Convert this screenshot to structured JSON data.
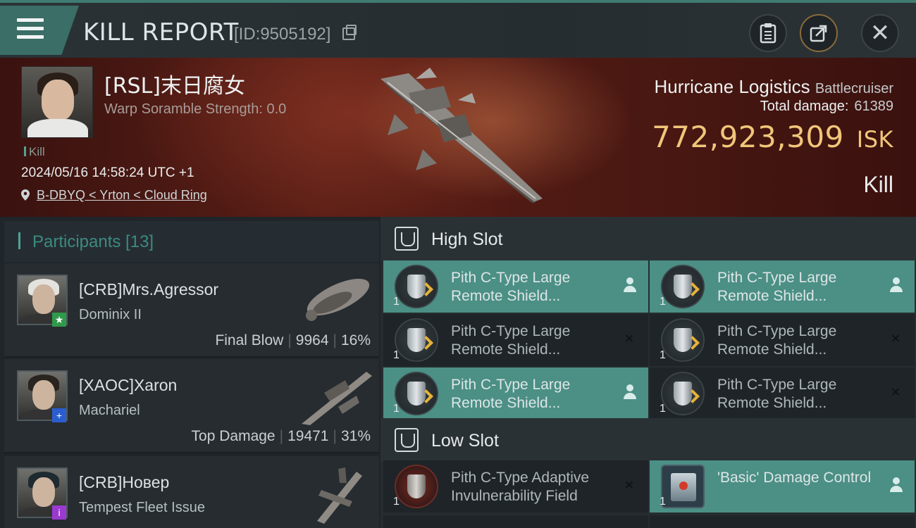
{
  "header": {
    "title": "KILL REPORT",
    "report_id": "[ID:9505192]"
  },
  "victim": {
    "name": "[RSL]末日腐女",
    "scramble": "Warp Soramble Strength: 0.0",
    "tag": "Kill",
    "datetime": "2024/05/16 14:58:24 UTC +1",
    "location": "B-DBYQ < Yrton < Cloud Ring",
    "ship": "Hurricane Logistics",
    "ship_class": "Battlecruiser",
    "total_damage_label": "Total damage:",
    "total_damage": "61389",
    "isk_value": "772,923,309",
    "isk_unit": "ISK",
    "result": "Kill"
  },
  "participants": {
    "header": "Participants [13]",
    "rows": [
      {
        "name": "[CRB]Mrs.Agressor",
        "ship": "Dominix II",
        "role": "Final Blow",
        "damage": "9964",
        "percent": "16%",
        "badge": "★",
        "badge_color": "#2f9a4a",
        "hair": "#e4e2dc"
      },
      {
        "name": "[XAOC]Xaron",
        "ship": "Machariel",
        "role": "Top Damage",
        "damage": "19471",
        "percent": "31%",
        "badge": "+",
        "badge_color": "#2a5ed0",
        "hair": "#2a2420"
      },
      {
        "name": "[CRB]Новер",
        "ship": "Tempest Fleet Issue",
        "role": "",
        "damage": "",
        "percent": "",
        "badge": "i",
        "badge_color": "#9a3ad0",
        "hair": "#1e2a30"
      }
    ]
  },
  "slots": {
    "high": {
      "label": "High Slot",
      "modules": [
        {
          "name": "Pith C-Type Large Remote Shield...",
          "qty": "1",
          "state": "dropped"
        },
        {
          "name": "Pith C-Type Large Remote Shield...",
          "qty": "1",
          "state": "dropped"
        },
        {
          "name": "Pith C-Type Large Remote Shield...",
          "qty": "1",
          "state": "destroyed"
        },
        {
          "name": "Pith C-Type Large Remote Shield...",
          "qty": "1",
          "state": "destroyed"
        },
        {
          "name": "Pith C-Type Large Remote Shield...",
          "qty": "1",
          "state": "dropped"
        },
        {
          "name": "Pith C-Type Large Remote Shield...",
          "qty": "1",
          "state": "destroyed"
        }
      ]
    },
    "low": {
      "label": "Low Slot",
      "modules": [
        {
          "name": "Pith C-Type Adaptive Invulnerability Field",
          "qty": "1",
          "state": "destroyed"
        },
        {
          "name": "'Basic' Damage Control",
          "qty": "1",
          "state": "dropped"
        }
      ]
    }
  },
  "icons": {
    "destroyed": "×"
  },
  "colors": {
    "accent": "#4b8f85",
    "isk": "#f0c67a"
  }
}
